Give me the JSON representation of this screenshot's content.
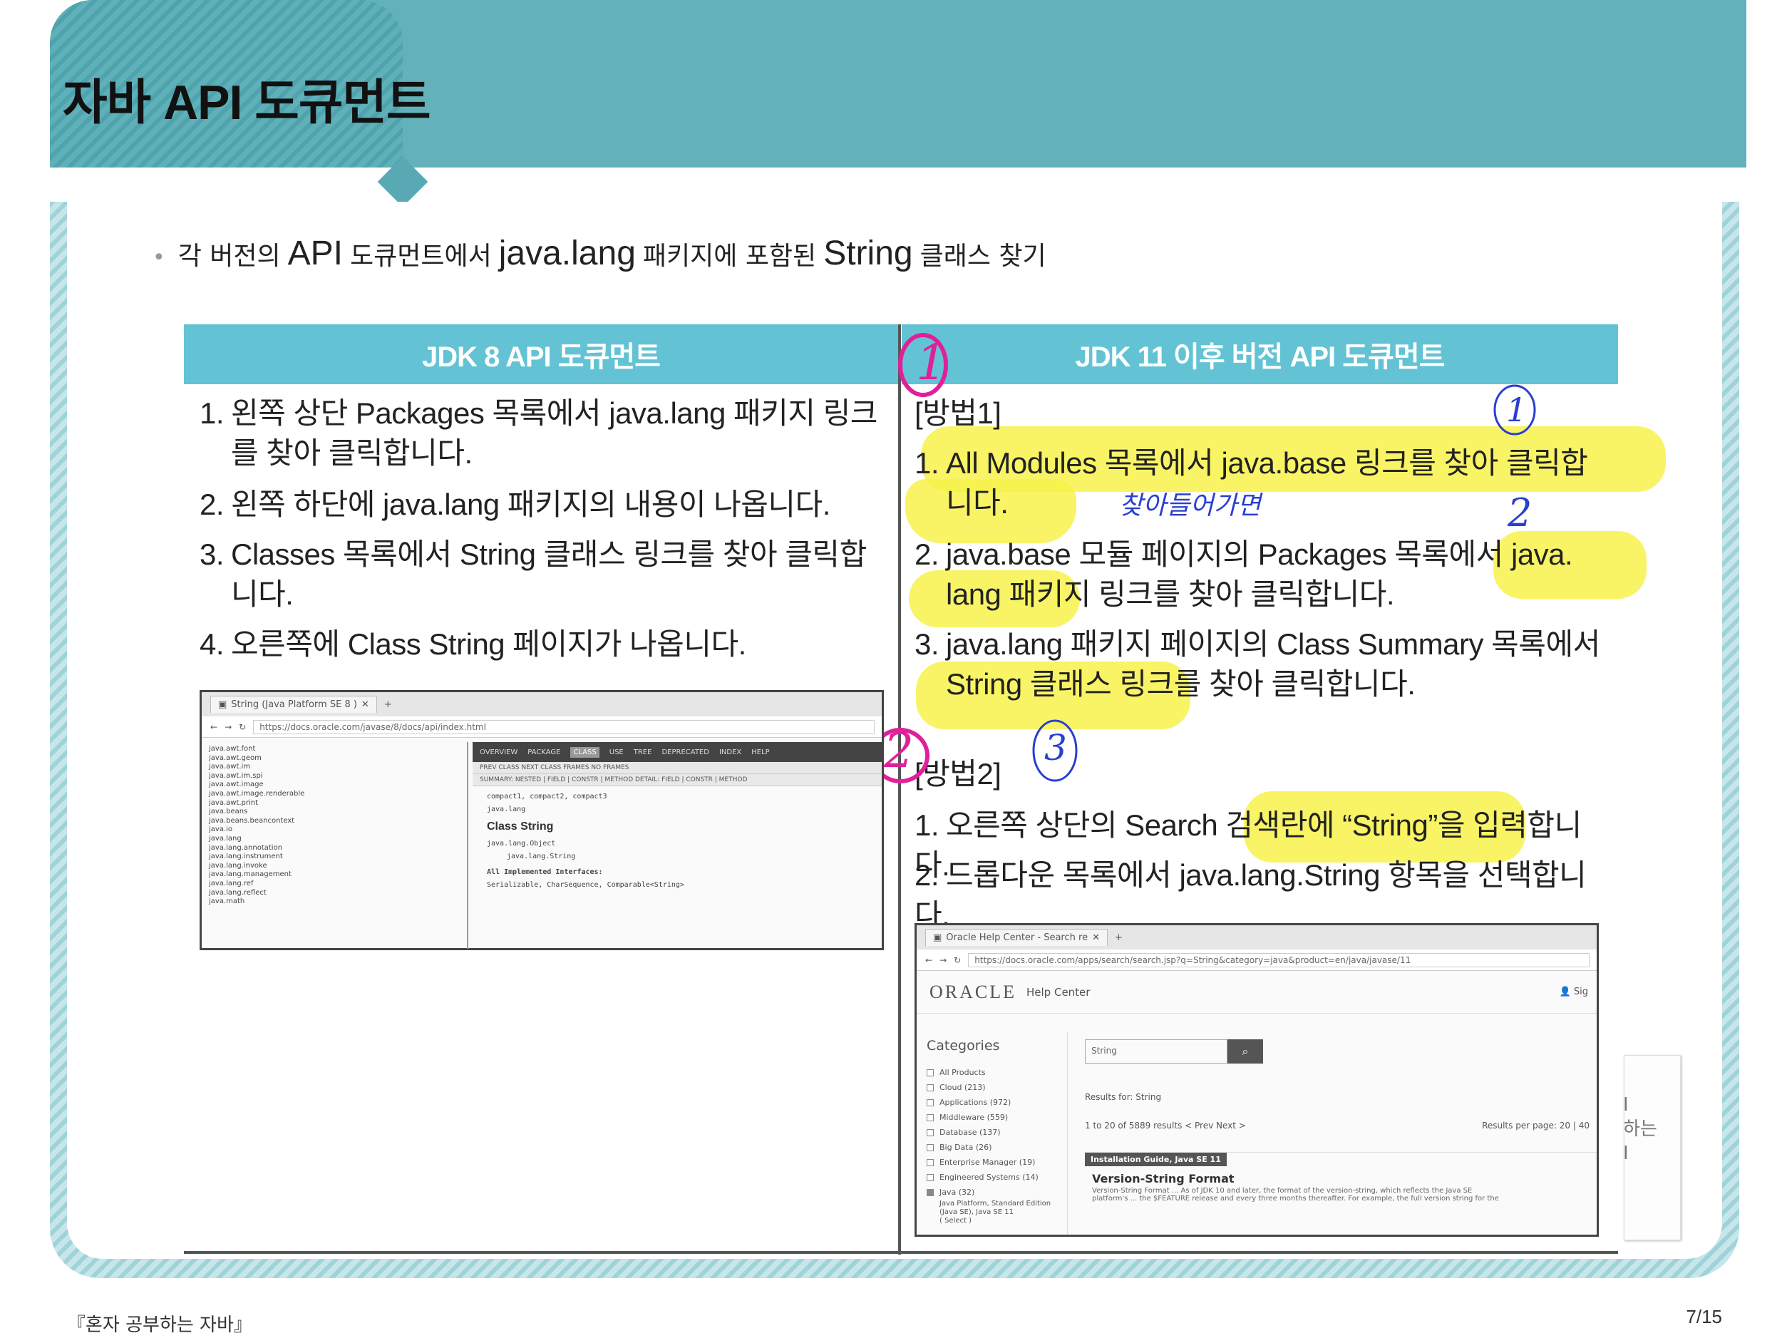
{
  "header": {
    "title": "자바 API 도큐먼트"
  },
  "intro": {
    "part1": "각 버전의",
    "api": "API",
    "part2": "도큐먼트에서",
    "pkg": "java.lang",
    "part3": "패키지에 포함된",
    "cls": "String",
    "part4": "클래스 찾기"
  },
  "table": {
    "left_header": "JDK 8 API 도큐먼트",
    "right_header": "JDK 11 이후 버전 API 도큐먼트",
    "left_items": [
      {
        "num": "1.",
        "line1": "왼쪽 상단 Packages 목록에서 java.lang 패키지 링크",
        "line2": "를 찾아 클릭합니다."
      },
      {
        "num": "2.",
        "line1": "왼쪽 하단에 java.lang 패키지의 내용이 나옵니다."
      },
      {
        "num": "3.",
        "line1": "Classes 목록에서 String 클래스 링크를 찾아 클릭합",
        "line2": "니다."
      },
      {
        "num": "4.",
        "line1": "오른쪽에 Class String 페이지가 나옵니다."
      }
    ],
    "method1_label": "[방법1]",
    "method1_items": [
      {
        "num": "1.",
        "line1": "All Modules 목록에서 java.base 링크를 찾아 클릭합",
        "line2": "니다."
      },
      {
        "num": "2.",
        "line1": "java.base 모듈 페이지의 Packages 목록에서 java.",
        "line2": "lang 패키지 링크를 찾아 클릭합니다."
      },
      {
        "num": "3.",
        "line1": "java.lang 패키지 페이지의 Class Summary 목록에서",
        "line2": "String 클래스 링크를 찾아 클릭합니다."
      }
    ],
    "method2_label": "[방법2]",
    "method2_items": [
      {
        "num": "1.",
        "line1": "오른쪽 상단의 Search 검색란에 “String”을 입력합니다."
      },
      {
        "num": "2.",
        "line1": "드롭다운 목록에서 java.lang.String 항목을 선택합니다."
      }
    ]
  },
  "annotations": {
    "pink1": "1",
    "pink2": "2",
    "blue1": "1",
    "blue2": "2",
    "blue3": "3",
    "blue_note": "찾아들어가면"
  },
  "shot1": {
    "tab_title": "String (Java Platform SE 8 )",
    "url": "https://docs.oracle.com/javase/8/docs/api/index.html",
    "packages": [
      "java.awt.font",
      "java.awt.geom",
      "java.awt.im",
      "java.awt.im.spi",
      "java.awt.image",
      "java.awt.image.renderable",
      "java.awt.print",
      "java.beans",
      "java.beans.beancontext",
      "java.io",
      "java.lang",
      "java.lang.annotation",
      "java.lang.instrument",
      "java.lang.invoke",
      "java.lang.management",
      "java.lang.ref",
      "java.lang.reflect",
      "java.math"
    ],
    "nav": [
      "OVERVIEW",
      "PACKAGE",
      "CLASS",
      "USE",
      "TREE",
      "DEPRECATED",
      "INDEX",
      "HELP"
    ],
    "nav_selected": "CLASS",
    "sub1": "PREV CLASS   NEXT CLASS       FRAMES   NO FRAMES",
    "sub2": "SUMMARY: NESTED | FIELD | CONSTR | METHOD     DETAIL: FIELD | CONSTR | METHOD",
    "profiles": "compact1, compact2, compact3",
    "package": "java.lang",
    "class_title": "Class String",
    "hierarchy1": "java.lang.Object",
    "hierarchy2": "java.lang.String",
    "impl_label": "All Implemented Interfaces:",
    "impl": "Serializable, CharSequence, Comparable<String>"
  },
  "shot2": {
    "tab_title": "Oracle Help Center - Search re",
    "url": "https://docs.oracle.com/apps/search/search.jsp?q=String&category=java&product=en/java/javase/11",
    "logo": "ORACLE",
    "help_center": "Help Center",
    "sign": "Sig",
    "categories_title": "Categories",
    "categories": [
      {
        "label": "All Products",
        "checked": false
      },
      {
        "label": "Cloud (213)",
        "checked": false
      },
      {
        "label": "Applications (972)",
        "checked": false
      },
      {
        "label": "Middleware (559)",
        "checked": false
      },
      {
        "label": "Database (137)",
        "checked": false
      },
      {
        "label": "Big Data (26)",
        "checked": false
      },
      {
        "label": "Enterprise Manager (19)",
        "checked": false
      },
      {
        "label": "Engineered Systems (14)",
        "checked": false
      },
      {
        "label": "Java (32)",
        "checked": true
      }
    ],
    "java_sub": "Java Platform, Standard Edition (Java SE), Java SE 11",
    "select": "( Select )",
    "search_value": "String",
    "results_for": "Results for: String",
    "range": "1 to 20 of 5889 results  < Prev  Next >",
    "per_page": "Results per page:  20  |  40",
    "card_tag": "Installation Guide, Java SE 11",
    "card_title": "Version-String Format",
    "card_snip1": "Version-String Format ... As of JDK 10 and later, the format of the version-string, which reflects the Java SE",
    "card_snip2": "platform's ... the $FEATURE release and every three months thereafter. For example, the full version string for the"
  },
  "book": {
    "text1": "하는",
    "text2": "I"
  },
  "footer": {
    "left": "『혼자 공부하는 자바』",
    "right": "7/15"
  },
  "colors": {
    "header": "#63b1bb",
    "table_header": "#63c3d4",
    "highlight": "#f7f24a",
    "pink": "#e0209a",
    "blue": "#2a3fd0"
  }
}
